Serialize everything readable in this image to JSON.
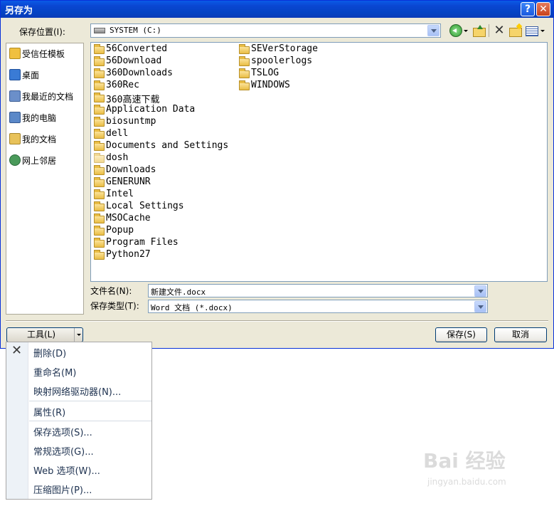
{
  "window": {
    "title": "另存为",
    "help_button": "?",
    "close_button": "✕"
  },
  "toolbar": {
    "save_in_label": "保存位置(I):",
    "save_in_value": "SYSTEM (C:)",
    "icons": [
      "back-icon",
      "up-folder-icon",
      "delete-icon",
      "new-folder-icon",
      "views-icon"
    ]
  },
  "places": [
    {
      "label": "受信任模板",
      "icon": "trusted-templates-icon",
      "color": "#f0c040"
    },
    {
      "label": "桌面",
      "icon": "desktop-icon",
      "color": "#3a7bd5"
    },
    {
      "label": "我最近的文档",
      "icon": "recent-documents-icon",
      "color": "#6b8fc9"
    },
    {
      "label": "我的电脑",
      "icon": "my-computer-icon",
      "color": "#5a88c8"
    },
    {
      "label": "我的文档",
      "icon": "my-documents-icon",
      "color": "#e8c25a"
    },
    {
      "label": "网上邻居",
      "icon": "network-places-icon",
      "color": "#4a9a5a"
    }
  ],
  "files": {
    "column1": [
      "56Converted",
      "56Download",
      "360Downloads",
      "360Rec",
      "360高速下载",
      "Application Data",
      "biosuntmp",
      "dell",
      "Documents and Settings",
      "dosh",
      "Downloads",
      "GENERUNR",
      "Intel",
      "Local Settings",
      "MSOCache",
      "Popup",
      "Program Files",
      "Python27"
    ],
    "column2": [
      "SEVerStorage",
      "spoolerlogs",
      "TSLOG",
      "WINDOWS"
    ]
  },
  "form": {
    "file_name_label": "文件名(N):",
    "file_name_value": "新建文件.docx",
    "file_type_label": "保存类型(T):",
    "file_type_value": "Word 文档 (*.docx)"
  },
  "buttons": {
    "tools": "工具(L)",
    "save": "保存(S)",
    "cancel": "取消"
  },
  "tools_menu": {
    "items": [
      {
        "label": "删除(D)"
      },
      {
        "label": "重命名(M)"
      },
      {
        "label": "映射网络驱动器(N)..."
      },
      {
        "label": "属性(R)"
      },
      {
        "label": "保存选项(S)..."
      },
      {
        "label": "常规选项(G)..."
      },
      {
        "label": "Web 选项(W)..."
      },
      {
        "label": "压缩图片(P)..."
      }
    ]
  },
  "watermark": {
    "line1": "Bai 经验",
    "line2": "jingyan.baidu.com"
  }
}
